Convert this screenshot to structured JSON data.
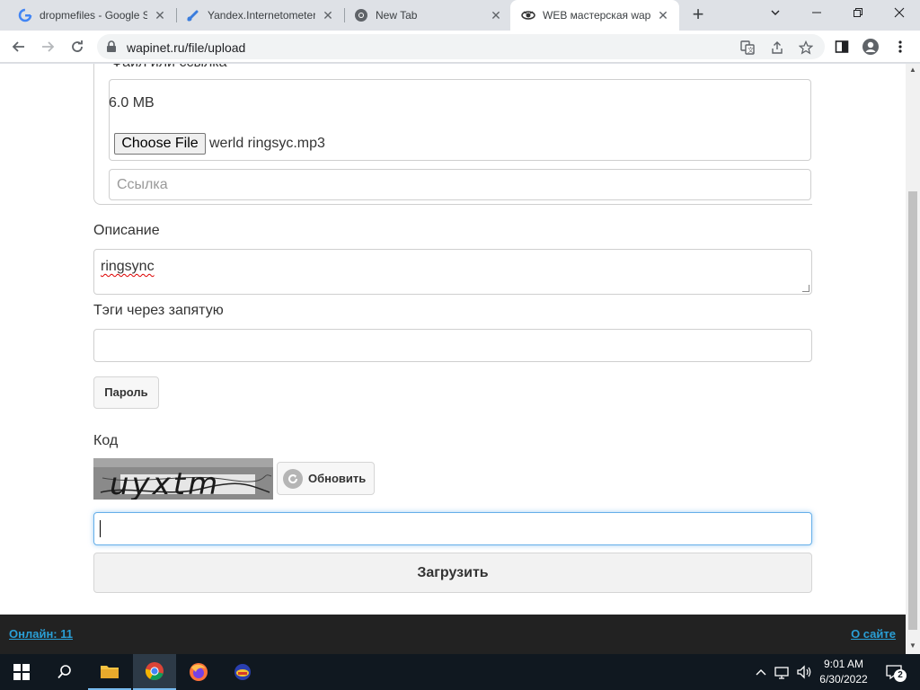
{
  "browser": {
    "tabs": [
      {
        "title": "dropmefiles - Google S",
        "icon": "google-icon"
      },
      {
        "title": "Yandex.Internetometer",
        "icon": "yandex-internetometer-icon"
      },
      {
        "title": "New Tab",
        "icon": "chrome-icon"
      },
      {
        "title": "WEB мастерская wapi",
        "icon": "wapinet-icon",
        "active": true
      }
    ],
    "url": "wapinet.ru/file/upload"
  },
  "form": {
    "file_legend": "Файл или ссылка",
    "file_size": "6.0 MB",
    "choose_file_label": "Choose File",
    "file_name": "werld ringsyc.mp3",
    "link_placeholder": "Ссылка",
    "description_label": "Описание",
    "description_value": "ringsync",
    "tags_label": "Тэги через запятую",
    "tags_value": "",
    "password_button": "Пароль",
    "code_label": "Код",
    "captcha_text": "uyxtm",
    "refresh_button": "Обновить",
    "code_value": "",
    "submit_button": "Загрузить"
  },
  "footer": {
    "online_link": "Онлайн: 11",
    "about_link": "О сайте"
  },
  "taskbar": {
    "apps": [
      "start-icon",
      "search-icon",
      "file-explorer-icon",
      "chrome-icon",
      "firefox-icon",
      "app-icon"
    ],
    "time": "9:01 AM",
    "date": "6/30/2022",
    "notifications": "2"
  }
}
